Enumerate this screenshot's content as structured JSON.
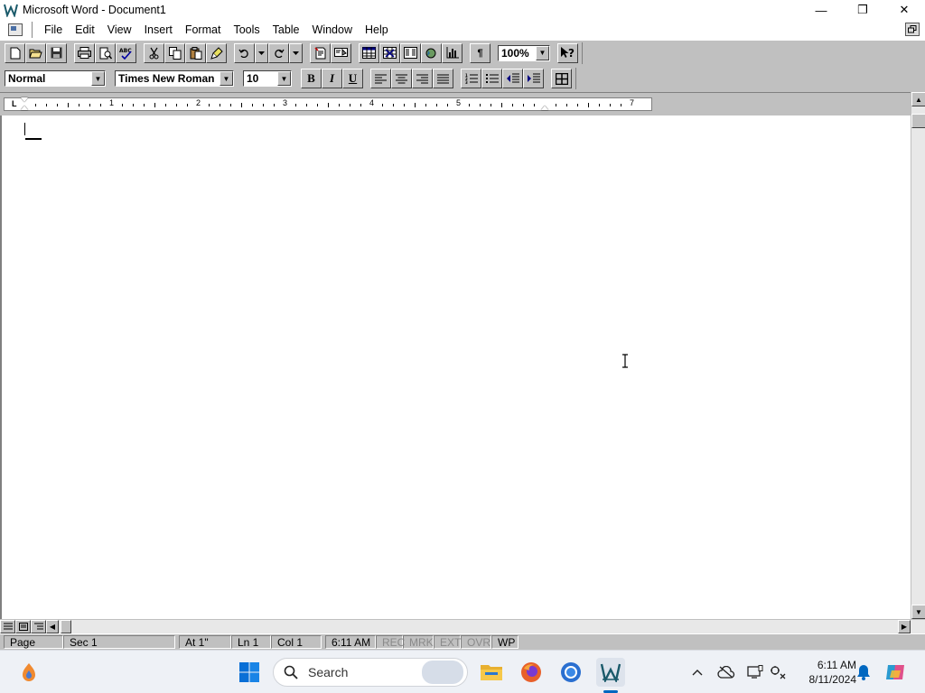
{
  "window": {
    "title": "Microsoft Word - Document1",
    "minimize": "—",
    "maximize": "❐",
    "close": "✕"
  },
  "menubar": {
    "items": [
      "File",
      "Edit",
      "View",
      "Insert",
      "Format",
      "Tools",
      "Table",
      "Window",
      "Help"
    ]
  },
  "toolbar": {
    "zoom": "100%",
    "show_hide_label": "¶"
  },
  "formatting": {
    "style": "Normal",
    "font": "Times New Roman",
    "size": "10",
    "bold": "B",
    "italic": "I",
    "underline": "U"
  },
  "ruler": {
    "tab_type": "L",
    "numbers": [
      "1",
      "2",
      "3",
      "4",
      "5",
      "7"
    ]
  },
  "statusbar": {
    "page": "Page",
    "section": "Sec 1",
    "at": "At 1\"",
    "line": "Ln 1",
    "col": "Col 1",
    "time": "6:11 AM",
    "rec": "REC",
    "mrk": "MRK",
    "ext": "EXT",
    "ovr": "OVR",
    "wp": "WP"
  },
  "taskbar": {
    "search_placeholder": "Search",
    "clock_time": "6:11 AM",
    "clock_date": "8/11/2024"
  },
  "colors": {
    "accent": "#0067c0",
    "chrome": "#c0c0c0"
  }
}
